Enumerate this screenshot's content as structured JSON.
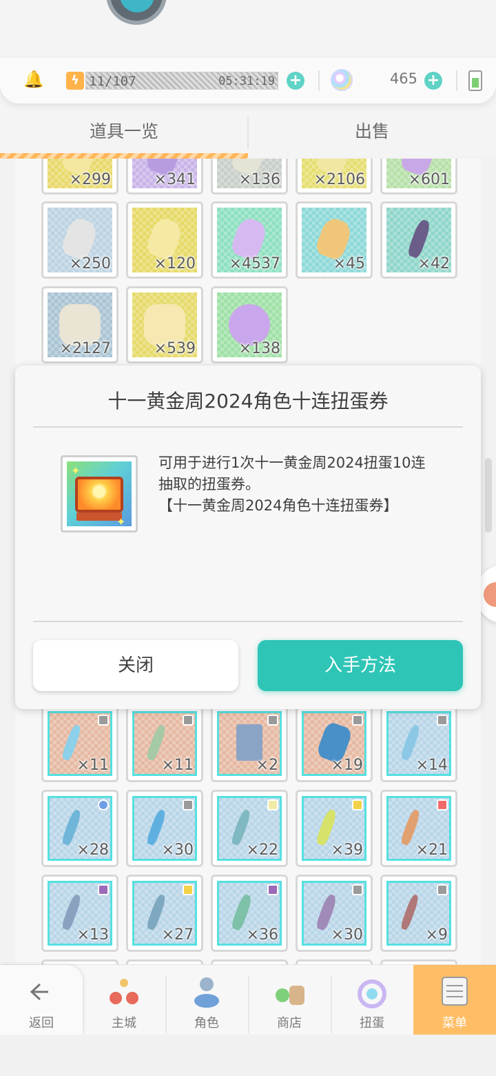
{
  "status": {
    "stamina": "11/107",
    "stamina_timer": "05:31:19",
    "gems": "465"
  },
  "tabs": [
    {
      "label": "道具一览",
      "active": true
    },
    {
      "label": "出售",
      "active": false
    }
  ],
  "inventory_rows": [
    [
      "×299",
      "×341",
      "×136",
      "×2106",
      "×601"
    ],
    [
      "×250",
      "×120",
      "×4537",
      "×45",
      "×42"
    ],
    [
      "×2127",
      "×539",
      "×138"
    ],
    [
      "×11",
      "×11",
      "×2",
      "×19",
      "×14"
    ],
    [
      "×28",
      "×30",
      "×22",
      "×39",
      "×21"
    ],
    [
      "×13",
      "×27",
      "×36",
      "×30",
      "×9"
    ]
  ],
  "modal": {
    "title": "十一黄金周2024角色十连扭蛋券",
    "description_line1": "可用于进行1次十一黄金周2024扭蛋10连",
    "description_line2": "抽取的扭蛋券。",
    "description_line3": "【十一黄金周2024角色十连扭蛋券】",
    "close_label": "关闭",
    "obtain_label": "入手方法"
  },
  "nav": [
    {
      "label": "返回",
      "icon": "back-arrow-icon"
    },
    {
      "label": "主城",
      "icon": "town-icon"
    },
    {
      "label": "角色",
      "icon": "character-icon"
    },
    {
      "label": "商店",
      "icon": "shop-icon"
    },
    {
      "label": "扭蛋",
      "icon": "gacha-icon"
    },
    {
      "label": "菜单",
      "icon": "menu-icon",
      "active": true
    }
  ],
  "colors": {
    "accent_teal": "#2ec5b6",
    "tab_orange": "#ffb65a",
    "menu_active": "#ffbe66"
  }
}
